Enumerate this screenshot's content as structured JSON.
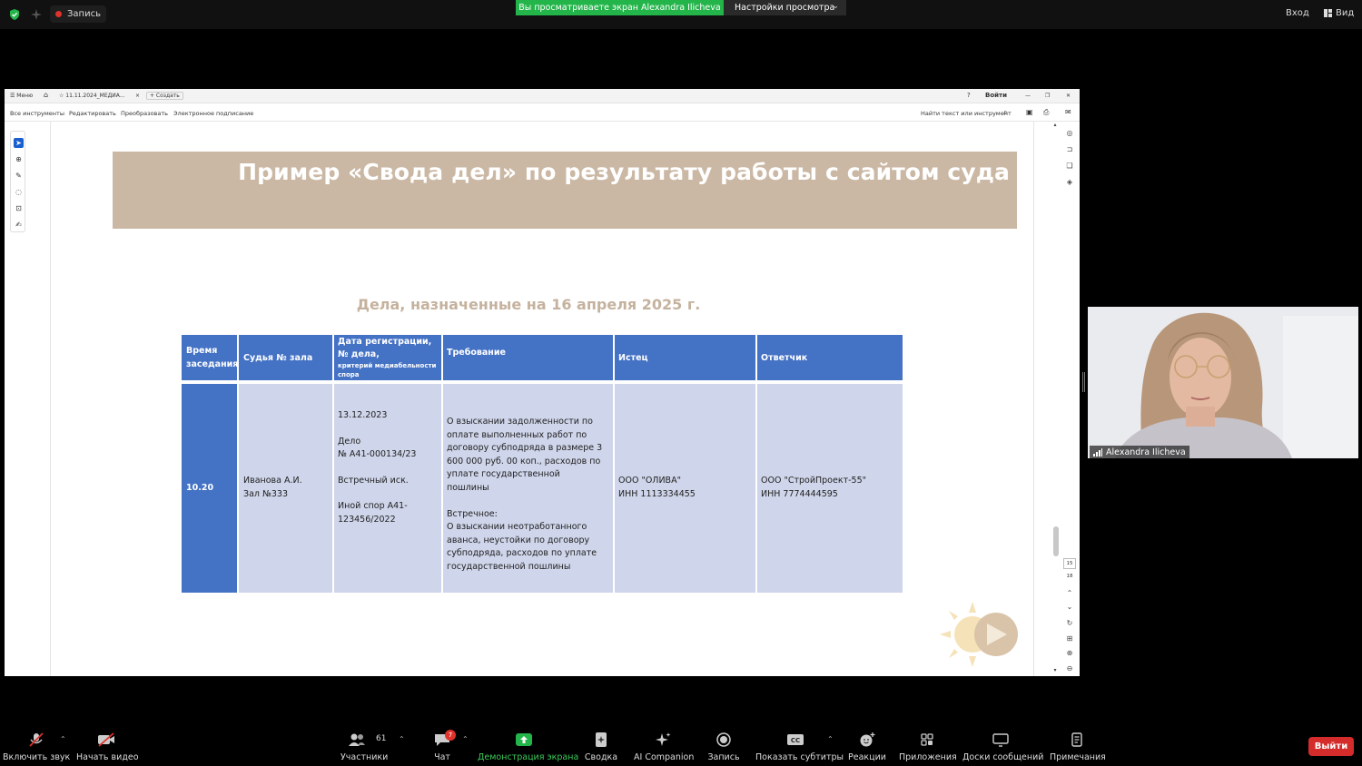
{
  "top_bar": {
    "record_label": "Запись",
    "viewing_banner": "Вы просматриваете экран Alexandra Ilicheva",
    "view_settings": "Настройки просмотра",
    "login": "Вход",
    "view": "Вид"
  },
  "viewer": {
    "menu": "Меню",
    "tab_title": "11.11.2024_МЕДИА...",
    "tab_close": "×",
    "new_tab": "+ Создать",
    "sign_in": "Войти",
    "menubar": [
      "Все инструменты",
      "Редактировать",
      "Преобразовать",
      "Электронное подписание"
    ],
    "find": "Найти текст или инструмент",
    "page_current": "15",
    "page_total": "18"
  },
  "slide": {
    "title": "Пример «Свода дел» по результату работы с сайтом суда",
    "subtitle": "Дела, назначенные на 16 апреля 2025 г.",
    "table": {
      "headers": {
        "time": "Время заседания",
        "judge": "Судья № зала",
        "reg_line1": "Дата регистрации,",
        "reg_line2": "№ дела,",
        "reg_small": "критерий медиабельности спора",
        "claim": "Требование",
        "plaintiff": "Истец",
        "defendant": "Ответчик"
      },
      "row": {
        "time": "10.20",
        "judge_1": "Иванова А.И.",
        "judge_2": "Зал №333",
        "reg_date": "13.12.2023",
        "case_label": "Дело",
        "case_no": "№ А41-000134/23",
        "counter": "Встречный иск.",
        "other_1": "Иной спор А41-",
        "other_2": "123456/2022",
        "claim_main": "О взыскании задолженности по оплате выполненных работ по договору субподряда в размере 3 600 000 руб. 00 коп., расходов по уплате государственной пошлины",
        "claim_counter_label": "Встречное:",
        "claim_counter": "О взыскании неотработанного аванса, неустойки по договору субподряда, расходов по уплате государственной пошлины",
        "plaintiff_1": "ООО \"ОЛИВА\"",
        "plaintiff_2": "ИНН 1113334455",
        "defendant_1": "ООО \"СтройПроект-55\"",
        "defendant_2": "ИНН 7774444595"
      }
    }
  },
  "participant": {
    "name": "Alexandra Ilicheva"
  },
  "toolbar": {
    "unmute": "Включить звук",
    "start_video": "Начать видео",
    "participants": "Участники",
    "participants_count": "61",
    "chat": "Чат",
    "chat_badge": "7",
    "share": "Демонстрация экрана",
    "summary": "Сводка",
    "ai": "AI Companion",
    "record": "Запись",
    "captions": "Показать субтитры",
    "reactions": "Реакции",
    "apps": "Приложения",
    "whiteboards": "Доски сообщений",
    "notes": "Примечания",
    "leave": "Выйти"
  },
  "colors": {
    "banner": "#cbb8a4",
    "table_header": "#4472c4",
    "table_body": "#cfd5ea",
    "share_green": "#23b54a",
    "leave_red": "#d42b2b"
  }
}
